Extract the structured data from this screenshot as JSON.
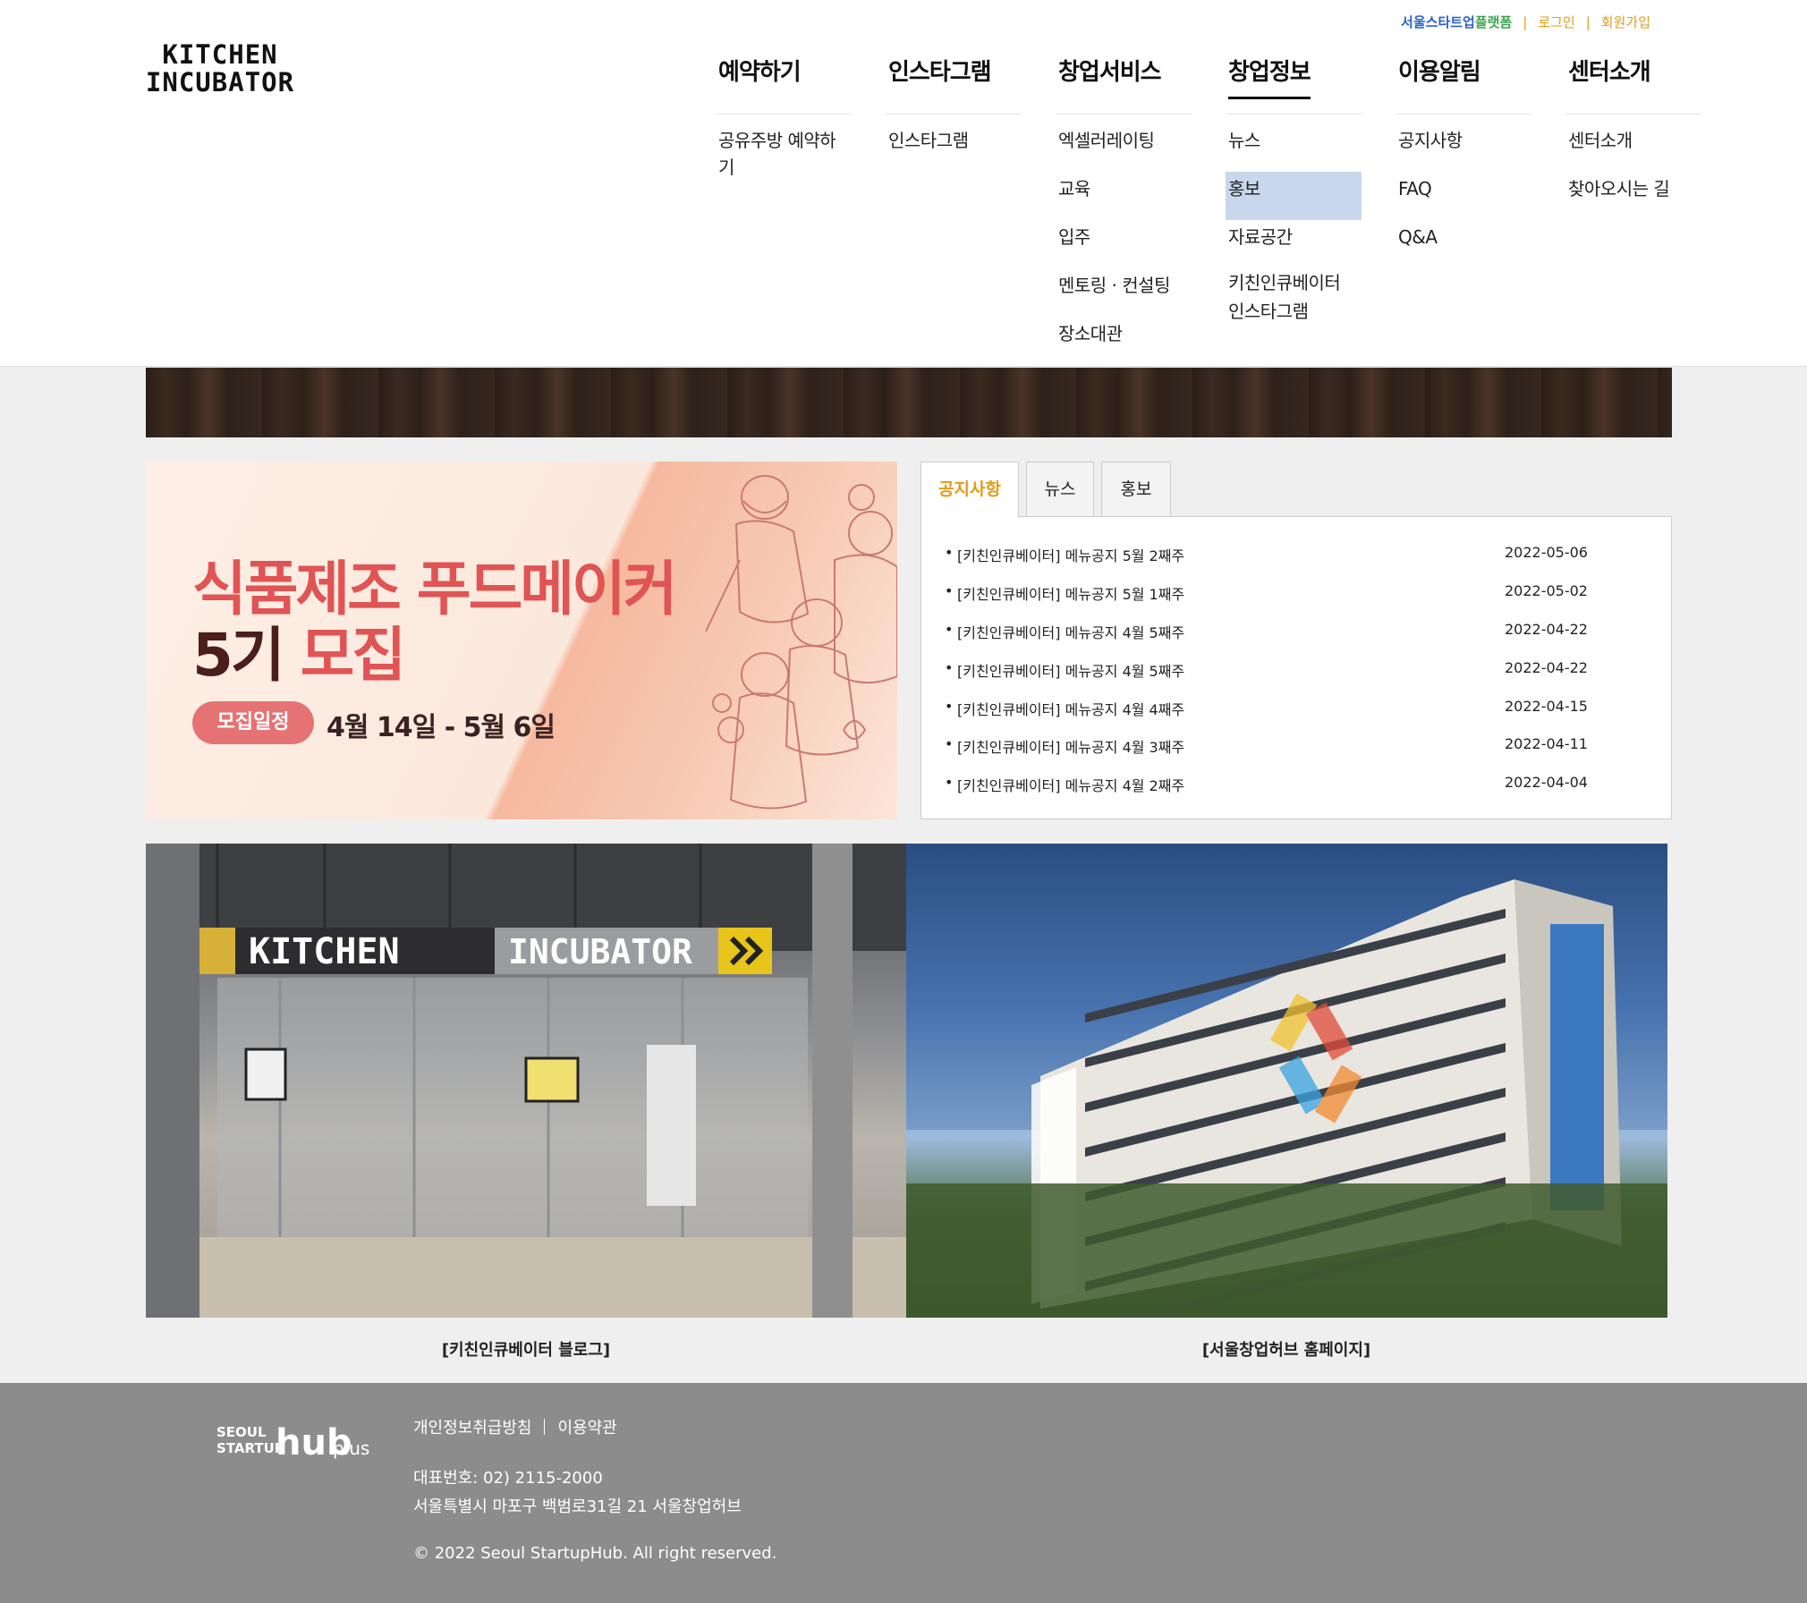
{
  "brand": {
    "logo_line1": "KITCHEN",
    "logo_line2": "INCUBATOR"
  },
  "util_nav": {
    "platform_part1": "서울스타트업",
    "platform_part2": "플랫폼",
    "separator": "|",
    "login": "로그인",
    "signup": "회원가입"
  },
  "gnb": [
    {
      "title": "예약하기",
      "items": [
        "공유주방 예약하기"
      ]
    },
    {
      "title": "인스타그램",
      "items": [
        "인스타그램"
      ]
    },
    {
      "title": "창업서비스",
      "items": [
        "엑셀러레이팅",
        "교육",
        "입주",
        "멘토링 · 컨설팅",
        "장소대관"
      ]
    },
    {
      "title": "창업정보",
      "items": [
        "뉴스",
        "홍보",
        "자료공간",
        "키친인큐베이터",
        "인스타그램"
      ]
    },
    {
      "title": "이용알림",
      "items": [
        "공지사항",
        "FAQ",
        "Q&A"
      ]
    },
    {
      "title": "센터소개",
      "items": [
        "센터소개",
        "찾아오시는 길"
      ]
    }
  ],
  "promo": {
    "title_line1": "식품제조 푸드메이커",
    "title_line2_num": "5기",
    "title_line2_rest": " 모집",
    "pill": "모집일정",
    "period": "4월 14일 - 5월 6일"
  },
  "board": {
    "tabs": [
      "공지사항",
      "뉴스",
      "홍보"
    ],
    "active_tab": "공지사항",
    "bullet": "•",
    "notices": [
      {
        "title": "[키친인큐베이터] 메뉴공지 5월 2째주",
        "date": "2022-05-06"
      },
      {
        "title": "[키친인큐베이터] 메뉴공지 5월 1째주",
        "date": "2022-05-02"
      },
      {
        "title": "[키친인큐베이터] 메뉴공지 4월 5째주",
        "date": "2022-04-22"
      },
      {
        "title": "[키친인큐베이터] 메뉴공지 4월 5째주",
        "date": "2022-04-22"
      },
      {
        "title": "[키친인큐베이터] 메뉴공지 4월 4째주",
        "date": "2022-04-15"
      },
      {
        "title": "[키친인큐베이터] 메뉴공지 4월 3째주",
        "date": "2022-04-11"
      },
      {
        "title": "[키친인큐베이터] 메뉴공지 4월 2째주",
        "date": "2022-04-04"
      }
    ]
  },
  "photos": {
    "left_sign_kitchen": "KITCHEN",
    "left_sign_incubator": "INCUBATOR",
    "left_caption": "[키친인큐베이터 블로그]",
    "right_caption": "[서울창업허브 홈페이지]"
  },
  "footer": {
    "logo_seoul": "SEOUL",
    "logo_startup": "STARTUP",
    "logo_hub": "hub",
    "logo_plus": "plus",
    "privacy": "개인정보취급방침",
    "terms": "이용약관",
    "tel": "대표번호: 02) 2115-2000",
    "address": "서울특별시 마포구 백범로31길 21 서울창업허브",
    "copyright": "© 2022 Seoul StartupHub. All right reserved."
  },
  "colors": {
    "accent_orange": "#e49a16",
    "link_blue": "#2a62c7",
    "link_green": "#3aa64a",
    "highlight": "#c8d7ec",
    "promo_red": "#e05454",
    "footer_bg": "#8c8c8c"
  }
}
